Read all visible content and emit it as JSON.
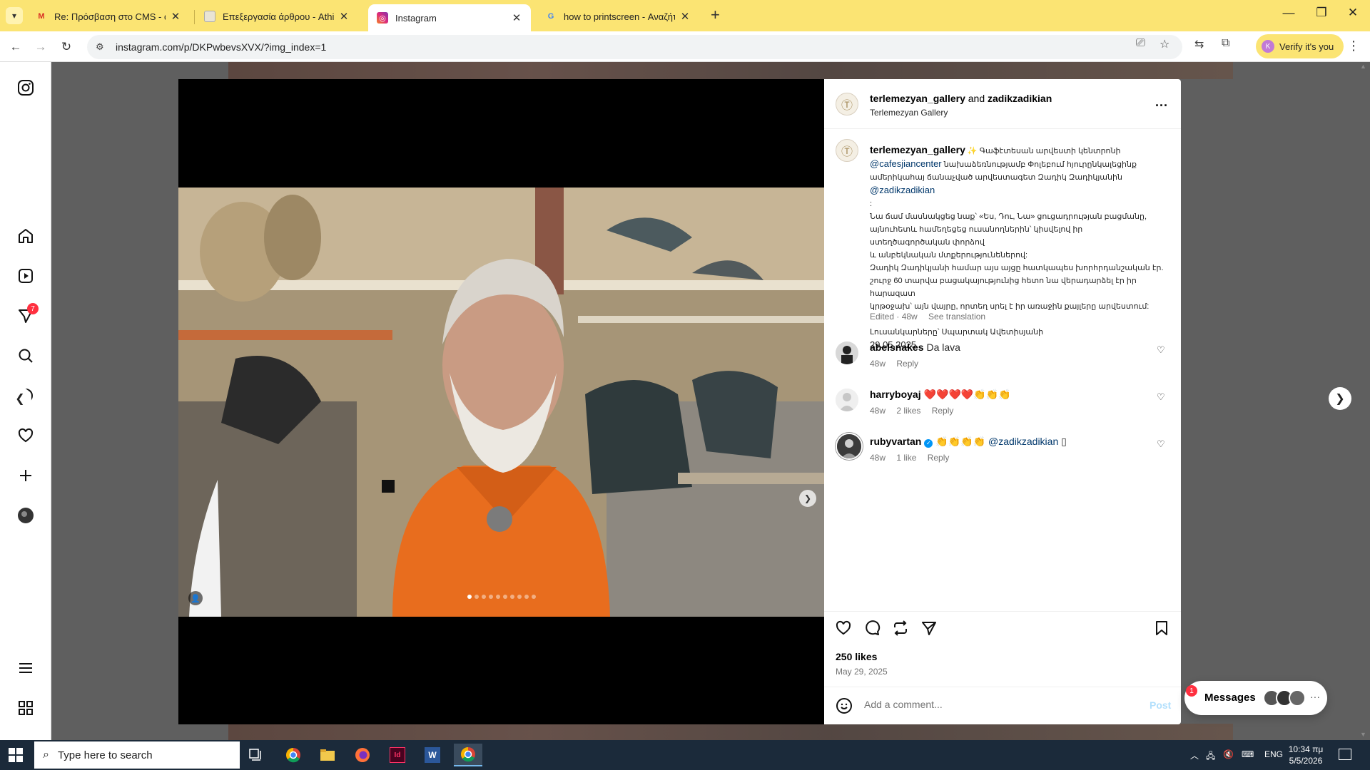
{
  "browser": {
    "tabs": [
      {
        "label": "Re: Πρόσβαση στο CMS - dimit",
        "favicon": "gmail-icon",
        "active": false
      },
      {
        "label": "Επεξεργασία άρθρου - Athinor",
        "favicon": "document-icon",
        "active": false
      },
      {
        "label": "Instagram",
        "favicon": "instagram-icon",
        "active": true
      },
      {
        "label": "how to printscreen - Αναζήτηση",
        "favicon": "google-icon",
        "active": false
      }
    ],
    "url": "instagram.com/p/DKPwbevsXVX/?img_index=1",
    "verify_label": "Verify it's you",
    "profile_initial": "K"
  },
  "sidebar": {
    "notifications_badge": "7",
    "items": [
      "instagram-logo-icon",
      "home-icon",
      "reels-icon",
      "messenger-icon",
      "search-icon",
      "explore-icon",
      "heart-icon",
      "create-icon",
      "profile-avatar",
      "menu-icon",
      "apps-icon"
    ]
  },
  "post": {
    "header": {
      "author": "terlemezyan_gallery",
      "and_text": "and",
      "coauthor": "zadikzadikian",
      "subtitle": "Terlemezyan Gallery",
      "more": "..."
    },
    "caption": {
      "user": "terlemezyan_gallery",
      "emoji": "✨",
      "intro": "Գաֆէտեսան արվեստի կենտրոնի",
      "mention1": "@cafesjiancenter",
      "line1b": "նախաձեռնությամբ Փոլեբում հյուրընկալեցինք",
      "line2": "ամերիկահայ ճանաչված արվեստագետ Զադիկ Զադիկյանին",
      "mention2": "@zadikzadikian",
      "colon": ":",
      "line3": "Նա ճամ մասնակցեց նաք՝ «Ես, Դու, Նա» ցուցադրության բացմանը,",
      "line4": "այնուհետև համեղեցեց ուսանողներին՝ կիսվելով իր ստեղծագործական փորձով",
      "line5": "և անբեկնական մտքերությունեներով:",
      "line6": "Զադիկ Զադիկյանի համար այս այցը հատկապես խորհրդանշական էր.",
      "line7": "շուրջ 60 տարվա բացակայությունից հետո նա վերադարձել էր իր հարազատ",
      "line8": "կրթօջախ՝ այն վայրը, որտեղ սրել է իր առաջին քայլերը արվեստում:",
      "credit": "Լուսանկարները՝ Սպարտակ Ավետիսյանի",
      "date": "29.05.2025",
      "meta_edited": "Edited · 48w",
      "meta_translate": "See translation"
    },
    "comments": [
      {
        "user": "abelsnakes",
        "text": "Da lava",
        "time": "48w",
        "likes": "",
        "reply": "Reply",
        "verified": false
      },
      {
        "user": "harryboyaj",
        "text": "❤️❤️❤️❤️👏👏👏",
        "time": "48w",
        "likes": "2 likes",
        "reply": "Reply",
        "verified": false
      },
      {
        "user": "rubyvartan",
        "text": "👏👏👏👏",
        "mention": "@zadikzadikian",
        "trailing": "▯",
        "time": "48w",
        "likes": "1 like",
        "reply": "Reply",
        "verified": true
      }
    ],
    "likes": "250 likes",
    "date": "May 29, 2025",
    "comment_placeholder": "Add a comment...",
    "post_label": "Post",
    "carousel": {
      "count": 10,
      "active_index": 0
    }
  },
  "messages": {
    "label": "Messages",
    "badge": "1"
  },
  "taskbar": {
    "search_placeholder": "Type here to search",
    "language": "ENG",
    "time": "10:34 πμ",
    "date": "5/5/2026"
  }
}
